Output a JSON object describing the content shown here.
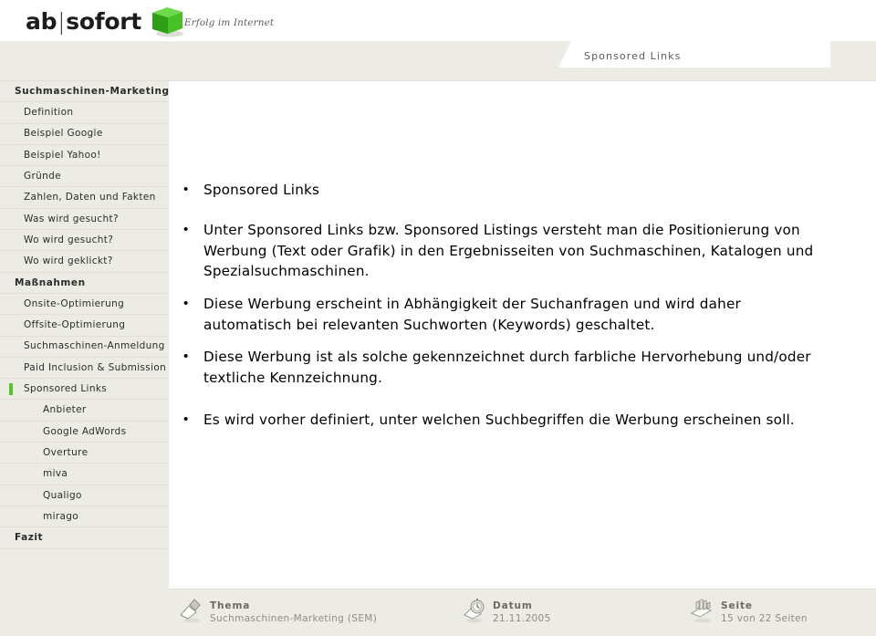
{
  "brand": {
    "name_part1": "ab",
    "separator": "|",
    "name_part2": "sofort",
    "tagline": "Erfolg im Internet",
    "cube_color": "#3fbd23",
    "accent_color": "#5cc22c"
  },
  "header": {
    "tab_title": "Sponsored Links"
  },
  "sidebar": {
    "items": [
      {
        "label": "Suchmaschinen-Marketing",
        "level": 0,
        "current": false
      },
      {
        "label": "Definition",
        "level": 1,
        "current": false
      },
      {
        "label": "Beispiel Google",
        "level": 1,
        "current": false
      },
      {
        "label": "Beispiel Yahoo!",
        "level": 1,
        "current": false
      },
      {
        "label": "Gründe",
        "level": 1,
        "current": false
      },
      {
        "label": "Zahlen, Daten und Fakten",
        "level": 1,
        "current": false
      },
      {
        "label": "Was wird gesucht?",
        "level": 1,
        "current": false
      },
      {
        "label": "Wo wird gesucht?",
        "level": 1,
        "current": false
      },
      {
        "label": "Wo wird geklickt?",
        "level": 1,
        "current": false
      },
      {
        "label": "Maßnahmen",
        "level": 0,
        "current": false
      },
      {
        "label": "Onsite-Optimierung",
        "level": 1,
        "current": false
      },
      {
        "label": "Offsite-Optimierung",
        "level": 1,
        "current": false
      },
      {
        "label": "Suchmaschinen-Anmeldung",
        "level": 1,
        "current": false
      },
      {
        "label": "Paid Inclusion & Submission",
        "level": 1,
        "current": false
      },
      {
        "label": "Sponsored Links",
        "level": 1,
        "current": true
      },
      {
        "label": "Anbieter",
        "level": 2,
        "current": false
      },
      {
        "label": "Google AdWords",
        "level": 2,
        "current": false
      },
      {
        "label": "Overture",
        "level": 2,
        "current": false
      },
      {
        "label": "miva",
        "level": 2,
        "current": false
      },
      {
        "label": "Qualigo",
        "level": 2,
        "current": false
      },
      {
        "label": "mirago",
        "level": 2,
        "current": false
      },
      {
        "label": "Fazit",
        "level": 0,
        "current": false
      }
    ]
  },
  "content": {
    "bullets": [
      {
        "marker": "•",
        "text": "Sponsored Links"
      },
      {
        "marker": "•",
        "text": "Unter Sponsored Links bzw. Sponsored Listings versteht man die Positionierung von Werbung (Text oder Grafik) in den Ergebnisseiten von Suchmaschinen, Katalogen und Spezialsuchmaschinen."
      },
      {
        "marker": "•",
        "text": "Diese Werbung erscheint in Abhängigkeit der Suchanfragen und wird daher automatisch bei relevanten Suchworten (Keywords) geschaltet."
      },
      {
        "marker": "•",
        "text": "Diese Werbung ist als solche gekennzeichnet durch farbliche Hervorhebung und/oder textliche Kennzeichnung."
      },
      {
        "marker": "•",
        "text": "Es wird vorher definiert, unter welchen Suchbegriffen die Werbung erscheinen soll."
      }
    ]
  },
  "footer": {
    "thema": {
      "icon": "pen-icon",
      "label": "Thema",
      "value": "Suchmaschinen-Marketing (SEM)"
    },
    "datum": {
      "icon": "clock-icon",
      "label": "Datum",
      "value": "21.11.2005"
    },
    "seite": {
      "icon": "pages-icon",
      "label": "Seite",
      "value": "15 von 22 Seiten"
    }
  }
}
